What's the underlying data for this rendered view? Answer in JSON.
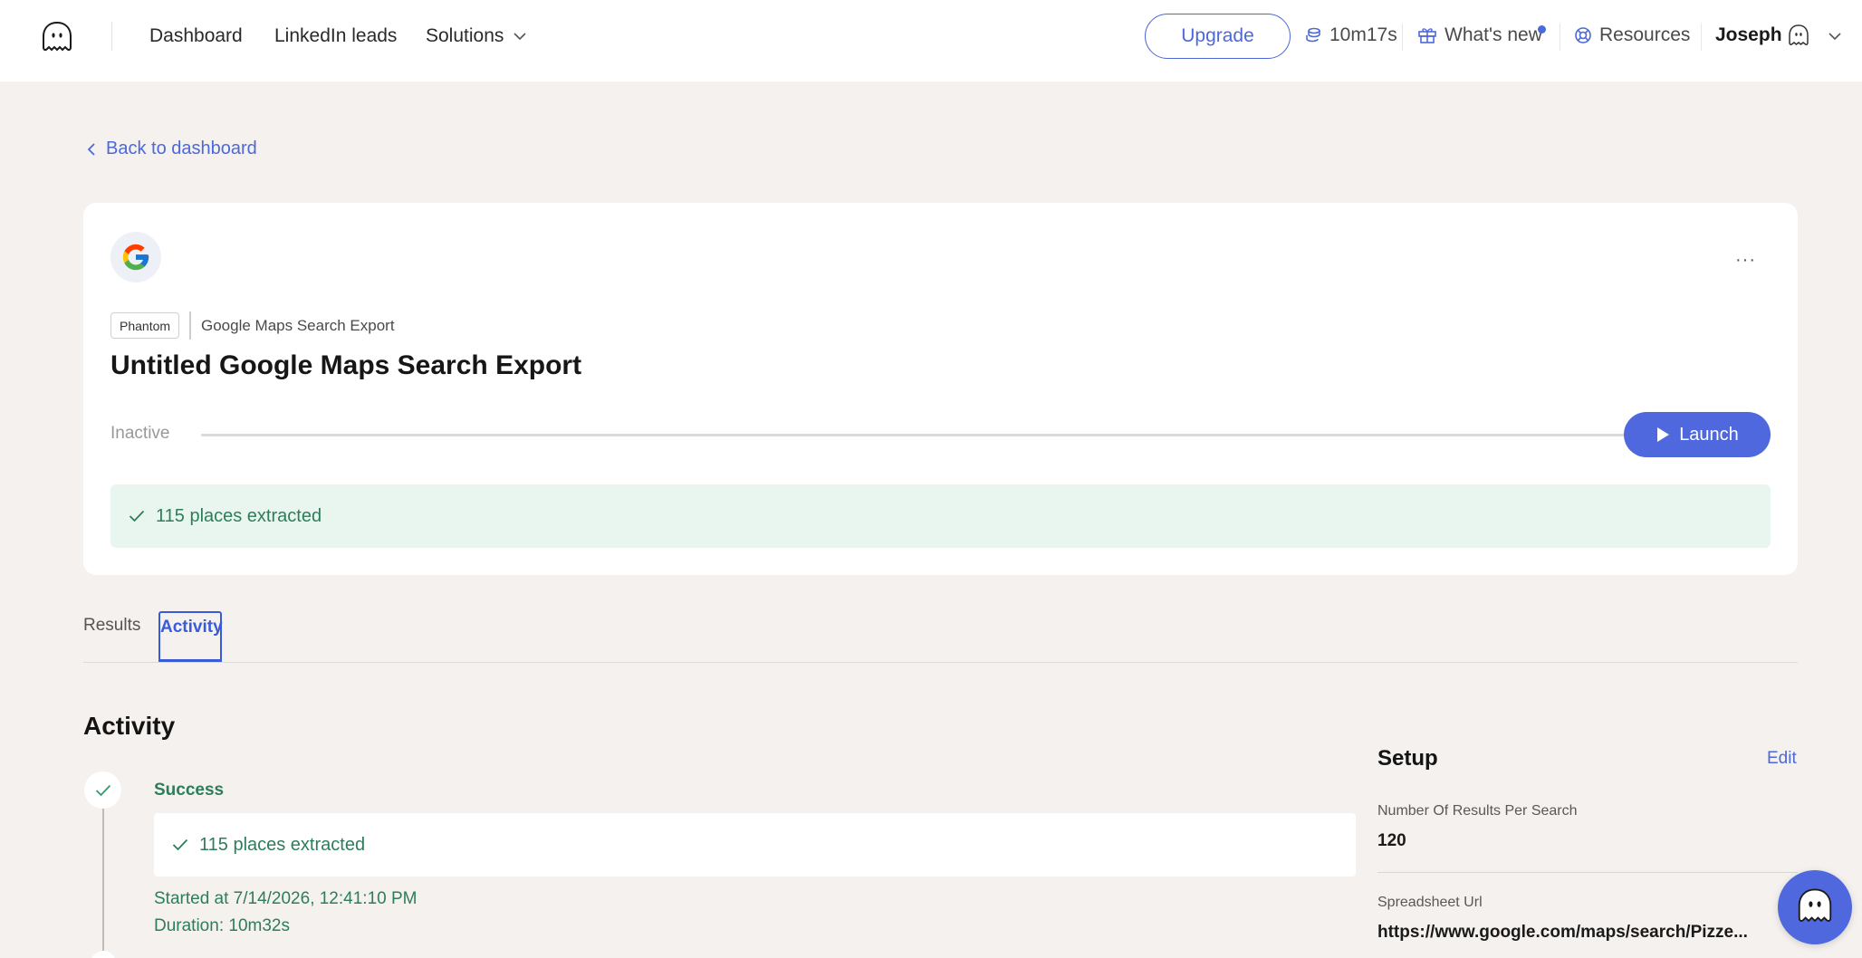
{
  "nav": {
    "logo_icon": "ghost-logo-icon",
    "links": [
      "Dashboard",
      "LinkedIn leads",
      "Solutions"
    ],
    "upgrade_label": "Upgrade",
    "time_remaining": "10m17s",
    "whats_new_label": "What's new",
    "resources_label": "Resources",
    "user_name": "Joseph"
  },
  "back_link": "Back to dashboard",
  "phantom": {
    "tag": "Phantom",
    "type": "Google Maps Search Export",
    "title": "Untitled Google Maps Search Export",
    "status": "Inactive",
    "launch_label": "Launch",
    "result_message": "115 places extracted",
    "more_label": "···"
  },
  "tabs": {
    "results": "Results",
    "activity": "Activity",
    "active": "Activity"
  },
  "activity": {
    "title": "Activity",
    "entries": [
      {
        "status": "Success",
        "message": "115 places extracted",
        "started": "Started at 7/14/2026, 12:41:10 PM",
        "duration": "Duration: 10m32s"
      }
    ]
  },
  "setup": {
    "title": "Setup",
    "edit_label": "Edit",
    "fields": [
      {
        "key": "Number Of Results Per Search",
        "value": "120"
      },
      {
        "key": "Spreadsheet Url",
        "value": "https://www.google.com/maps/search/Pizze..."
      }
    ]
  },
  "colors": {
    "accent": "#4d68d9",
    "launch": "#5068dd",
    "success": "#2e7d5a",
    "success_bg": "#e9f6ef",
    "page_bg": "#f4f1ee"
  }
}
